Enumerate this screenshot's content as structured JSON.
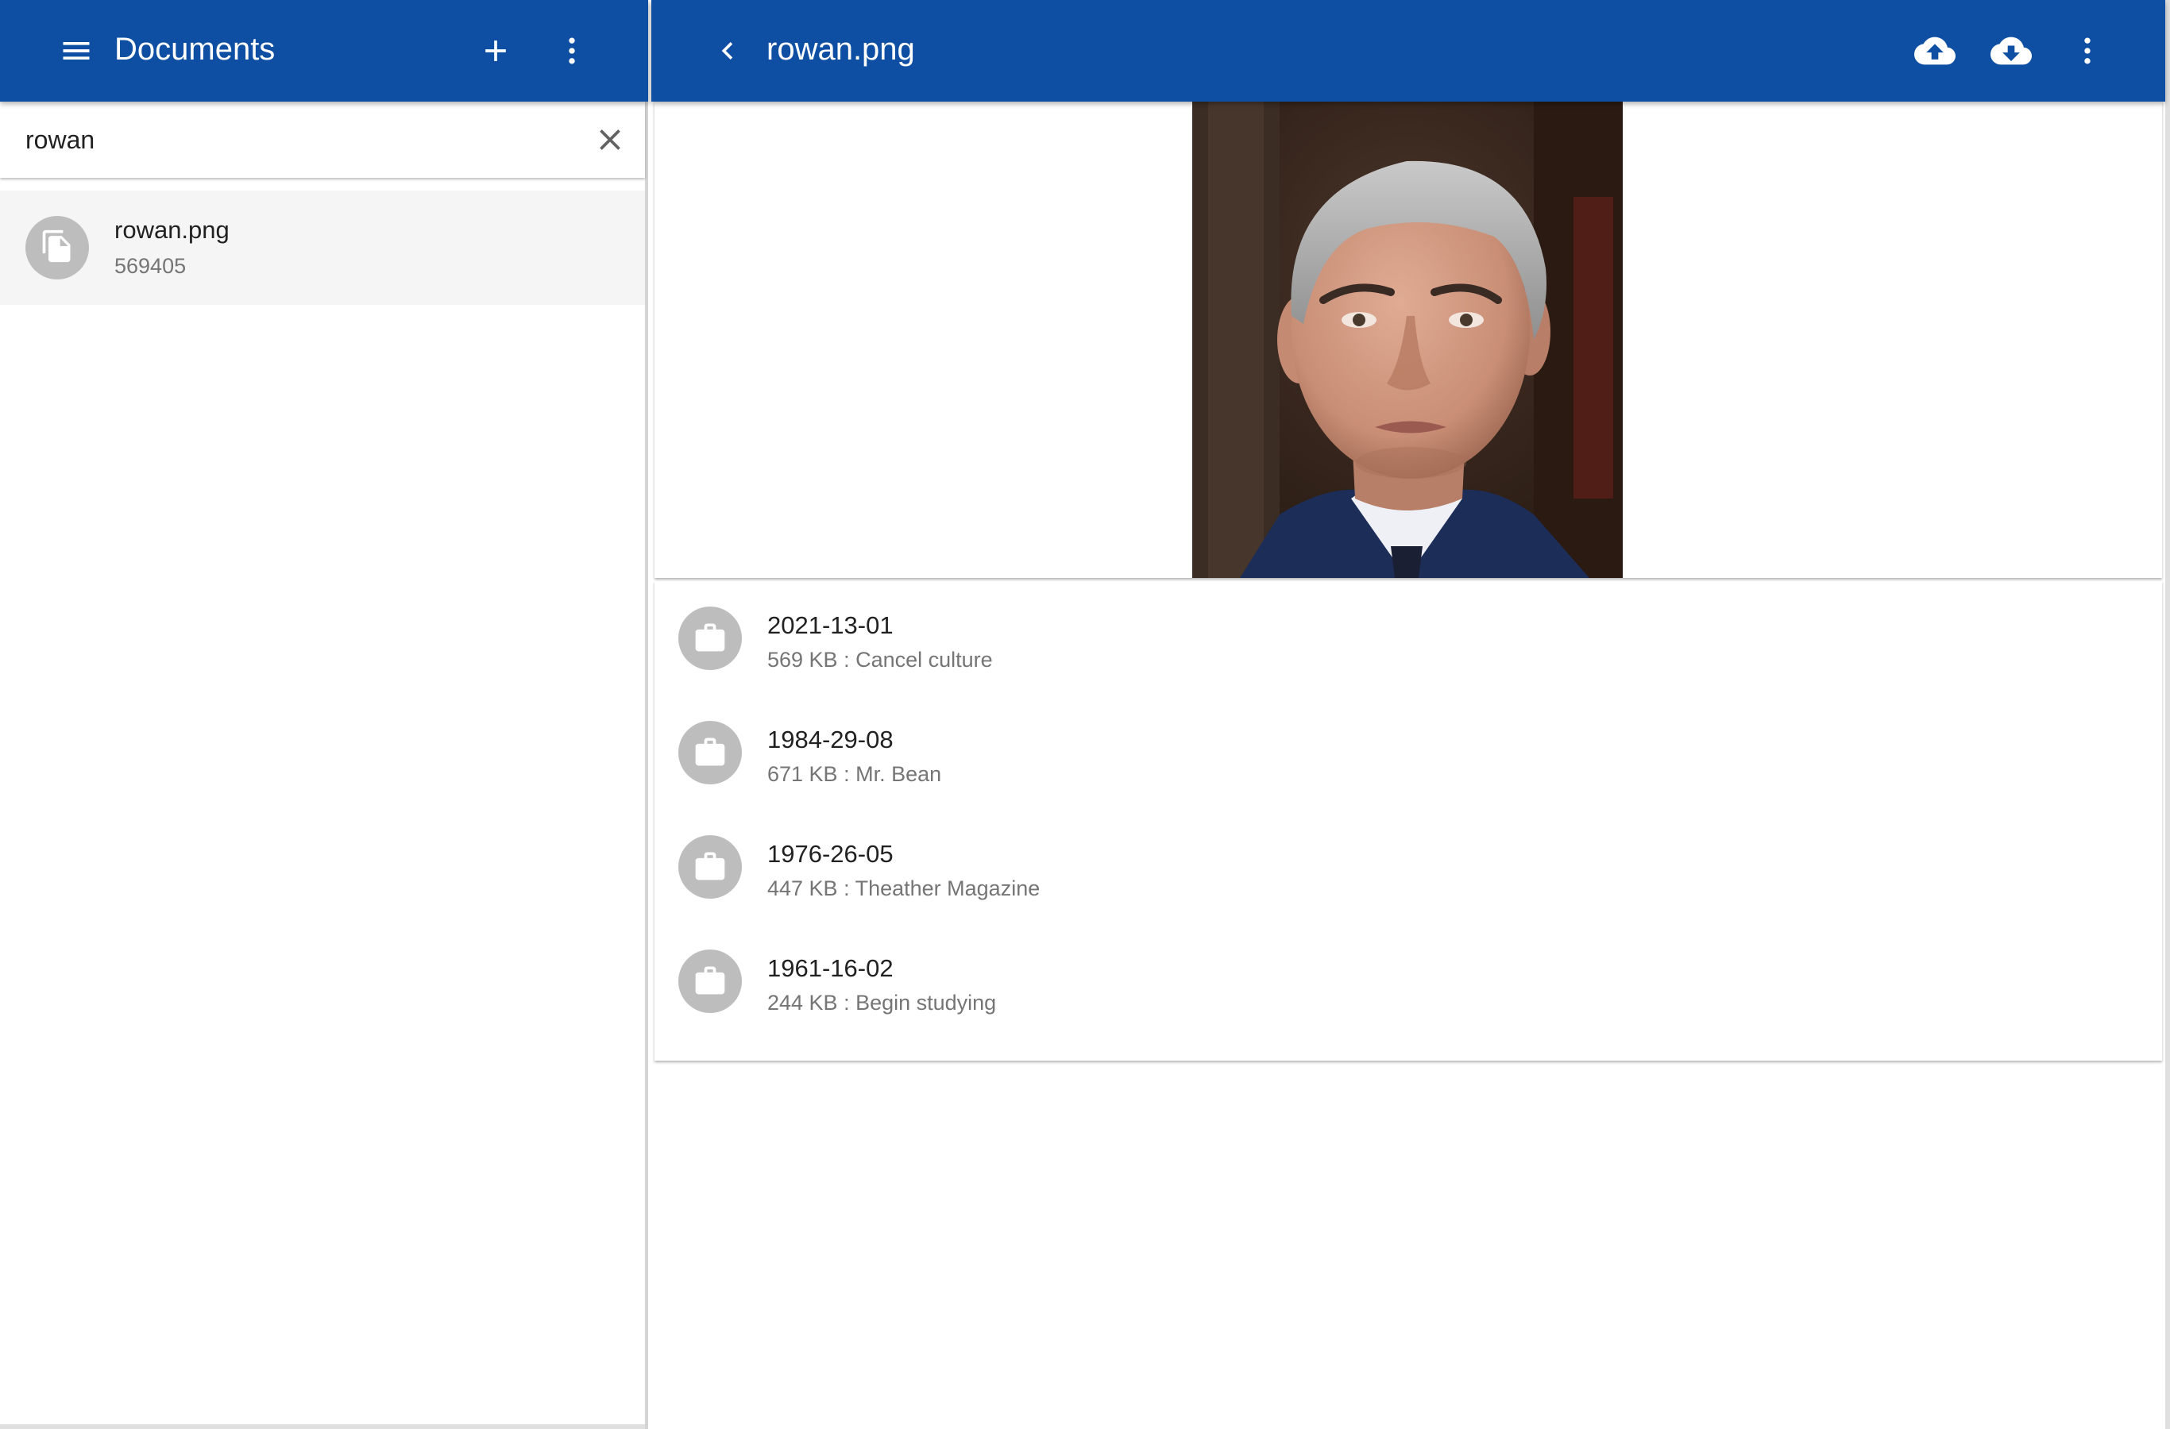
{
  "left_panel": {
    "title": "Documents",
    "search": {
      "value": "rowan",
      "placeholder": ""
    },
    "results": [
      {
        "name": "rowan.png",
        "size": "569405"
      }
    ]
  },
  "right_panel": {
    "title": "rowan.png",
    "image_alt": "rowan.png",
    "history": [
      {
        "date": "2021-13-01",
        "detail": "569 KB : Cancel culture"
      },
      {
        "date": "1984-29-08",
        "detail": "671 KB : Mr. Bean"
      },
      {
        "date": "1976-26-05",
        "detail": "447 KB : Theather Magazine"
      },
      {
        "date": "1961-16-02",
        "detail": "244 KB : Begin studying"
      }
    ]
  },
  "icons": {
    "menu": "menu-icon",
    "add": "add-icon",
    "more": "more-vert-icon",
    "clear": "close-icon",
    "back": "chevron-left-icon",
    "upload": "cloud-upload-icon",
    "download": "cloud-download-icon",
    "file": "file-copy-icon",
    "version": "briefcase-icon"
  },
  "colors": {
    "appbar": "#0e4fa4",
    "selected_row": "#f5f5f5",
    "avatar": "#bdbdbd",
    "primary_text": "#212121",
    "secondary_text": "#757575"
  }
}
